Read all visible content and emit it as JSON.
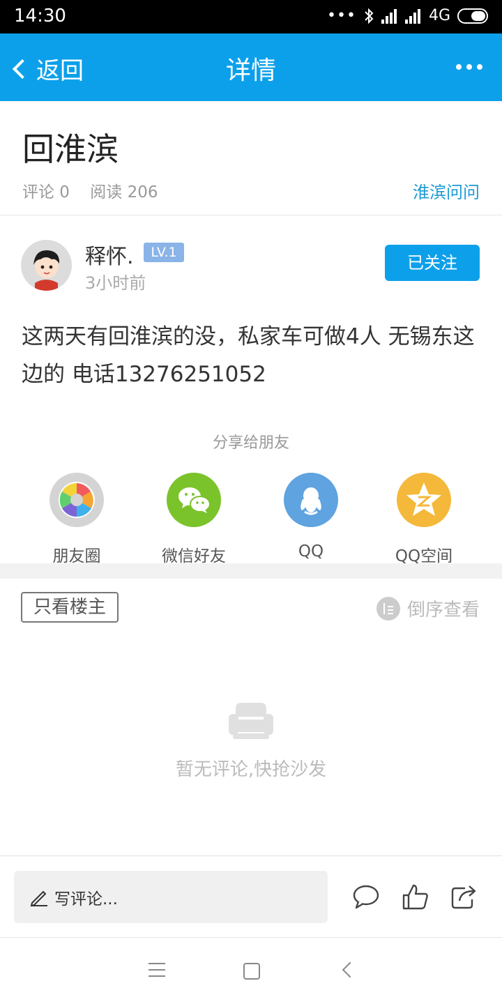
{
  "status_bar": {
    "time": "14:30",
    "network": "4G"
  },
  "header": {
    "back_label": "返回",
    "title": "详情"
  },
  "post": {
    "title": "回淮滨",
    "comment_count_label": "评论 0",
    "read_count_label": "阅读 206",
    "category": "淮滨问问",
    "author": {
      "name": "释怀.",
      "level": "LV.1",
      "time": "3小时前",
      "follow_label": "已关注"
    },
    "content": "这两天有回淮滨的没，私家车可做4人 无锡东这边的 电话13276251052"
  },
  "share": {
    "title": "分享给朋友",
    "items": [
      {
        "label": "朋友圈",
        "icon": "moments-icon",
        "color": "#d4d4d4"
      },
      {
        "label": "微信好友",
        "icon": "wechat-icon",
        "color": "#7bc32b"
      },
      {
        "label": "QQ",
        "icon": "qq-icon",
        "color": "#5fa3e0"
      },
      {
        "label": "QQ空间",
        "icon": "qzone-icon",
        "color": "#f4b93a"
      }
    ]
  },
  "comments": {
    "only_owner_label": "只看楼主",
    "reverse_label": "倒序查看",
    "empty_text": "暂无评论,快抢沙发"
  },
  "bottom_bar": {
    "comment_placeholder": "写评论..."
  },
  "colors": {
    "accent": "#0da0ea",
    "category": "#1b9ad6",
    "level_badge": "#8ab4e8"
  }
}
